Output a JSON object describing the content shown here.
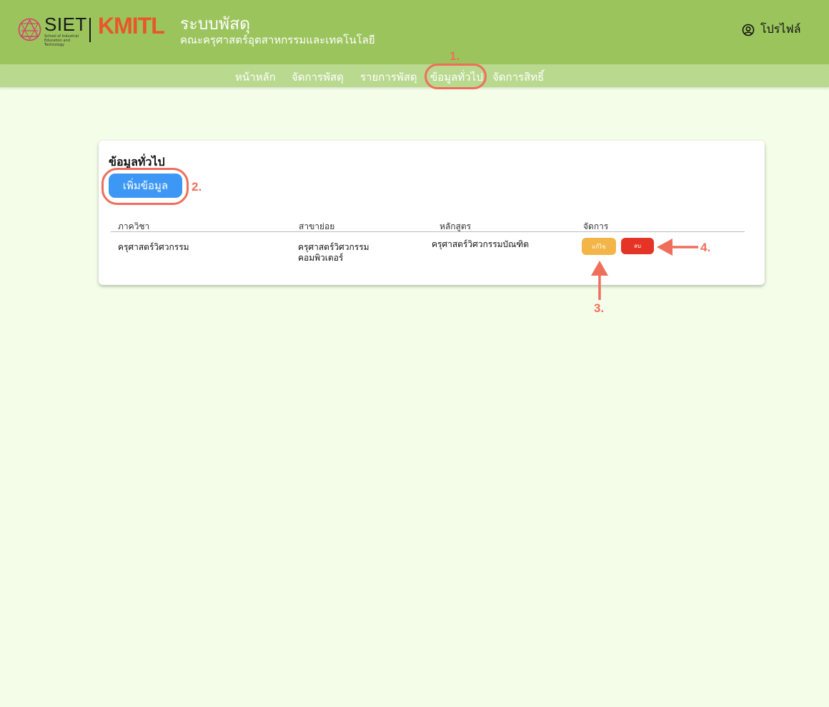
{
  "header": {
    "siet_logo_text": "SIET",
    "siet_logo_subtext": "School of Industrial Education and Technology",
    "kmitl_logo_text": "KMITL",
    "title": "ระบบพัสดุ",
    "subtitle": "คณะครุศาสตร์อุตสาหกรรมและเทคโนโลยี",
    "profile_label": "โปรไฟล์"
  },
  "nav": {
    "items": [
      {
        "label": "หน้าหลัก"
      },
      {
        "label": "จัดการพัสดุ"
      },
      {
        "label": "รายการพัสดุ"
      },
      {
        "label": "ข้อมูลทั่วไป"
      },
      {
        "label": "จัดการสิทธิ์"
      }
    ]
  },
  "card": {
    "title": "ข้อมูลทั่วไป",
    "add_button_label": "เพิ่มข้อมูล"
  },
  "table": {
    "columns": [
      "ภาควิชา",
      "สาขาย่อย",
      "หลักสูตร",
      "จัดการ"
    ],
    "rows": [
      {
        "department": "ครุศาสตร์วิศวกรรม",
        "subfield_line1": "ครุศาสตร์วิศวกรรม",
        "subfield_line2": "คอมพิวเตอร์",
        "curriculum": "ครุศาสตร์วิศวกรรมบัณฑิต",
        "edit_label": "แก้ไข",
        "delete_label": "ลบ"
      }
    ]
  },
  "annotations": [
    "1.",
    "2.",
    "3.",
    "4."
  ],
  "colors": {
    "header_bg": "#9bc45d",
    "nav_bg": "#b9d98f",
    "page_bg": "#f4fde8",
    "primary": "#3d97f5",
    "edit": "#f3b547",
    "delete": "#e53425",
    "annotation": "#ef6e5b",
    "kmitl": "#e8572a"
  }
}
